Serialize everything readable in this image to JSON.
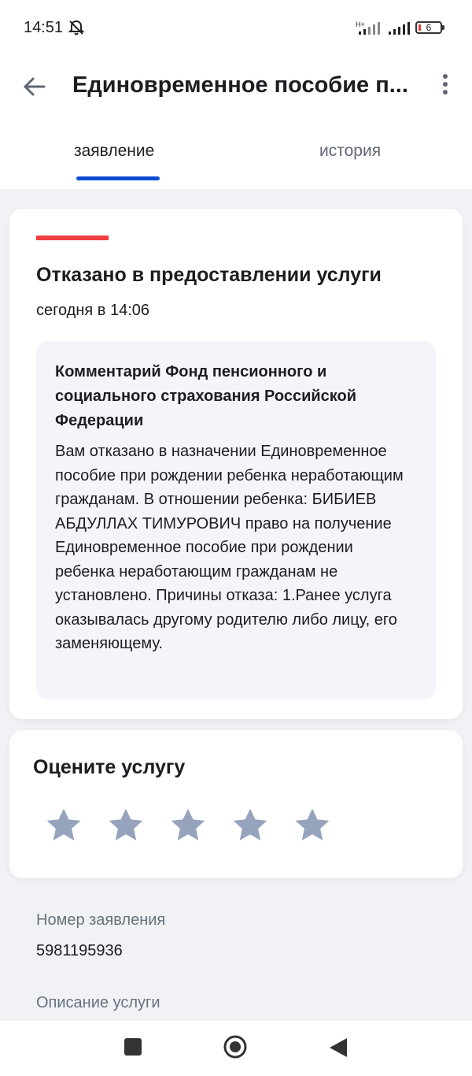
{
  "status_bar": {
    "time": "14:51",
    "battery": "6",
    "network_label": "H+"
  },
  "header": {
    "title": "Единовременное пособие п..."
  },
  "tabs": [
    {
      "label": "заявление",
      "active": true
    },
    {
      "label": "история",
      "active": false
    }
  ],
  "status_card": {
    "title": "Отказано в предоставлении услуги",
    "date": "сегодня в 14:06",
    "comment_title": "Комментарий Фонд пенсионного и социального страхования Российской Федерации",
    "comment_text": "Вам отказано в назначении Единовременное пособие при рождении ребенка неработающим гражданам. В отношении ребенка: БИБИЕВ АБДУЛЛАХ ТИМУРОВИЧ право на получение Единовременное пособие при рождении ребенка неработающим гражданам не установлено. Причины отказа: 1.Ранее услуга оказывалась другому родителю либо лицу, его заменяющему."
  },
  "rating": {
    "title": "Оцените услугу",
    "stars_total": 5,
    "stars_selected": 0
  },
  "info": {
    "number_label": "Номер заявления",
    "number_value": "5981195936",
    "description_label": "Описание услуги"
  },
  "colors": {
    "accent": "#0d4cd3",
    "error": "#ee3f3f",
    "star": "#95a3bd"
  }
}
